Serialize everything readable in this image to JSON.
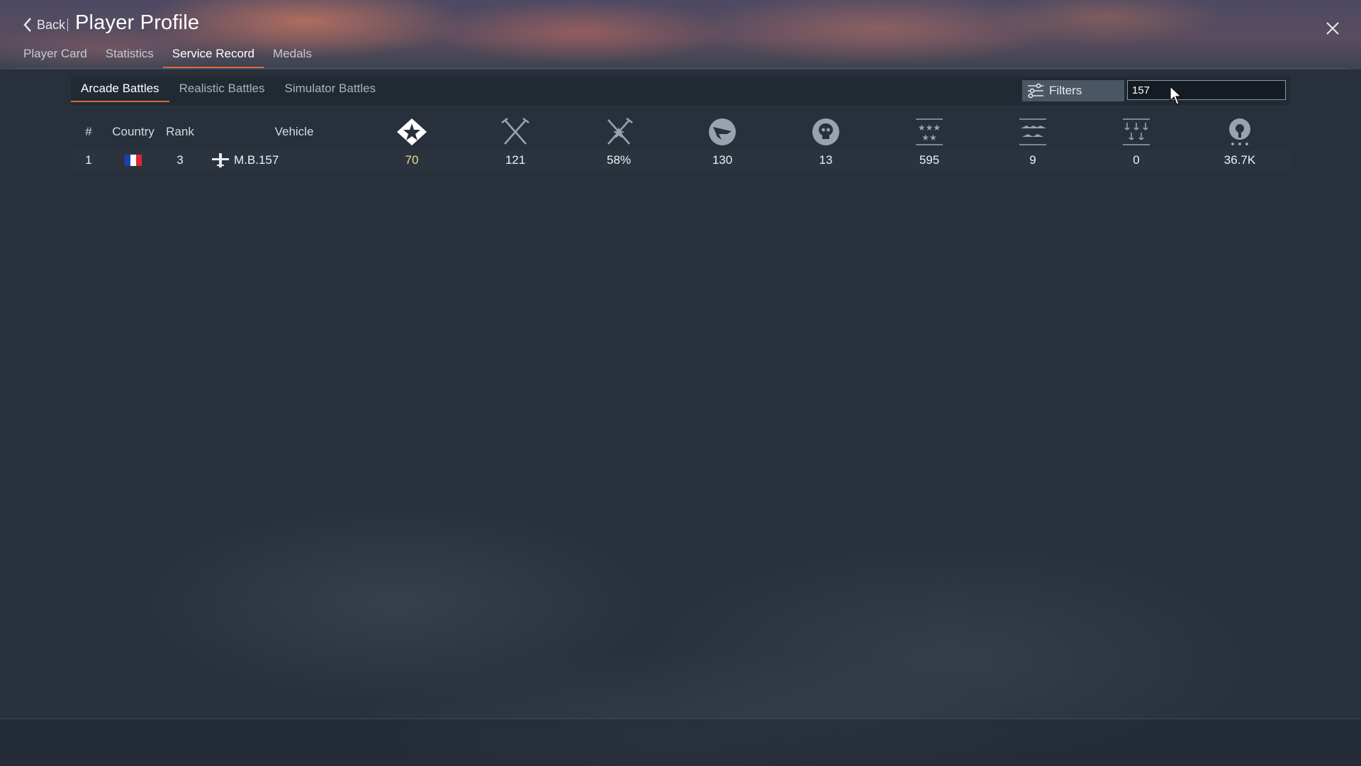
{
  "header": {
    "back_label": "Back",
    "title": "Player Profile",
    "close_icon": "close-icon"
  },
  "main_tabs": [
    {
      "label": "Player Card",
      "active": false
    },
    {
      "label": "Statistics",
      "active": false
    },
    {
      "label": "Service Record",
      "active": true
    },
    {
      "label": "Medals",
      "active": false
    }
  ],
  "sub_tabs": [
    {
      "label": "Arcade Battles",
      "active": true
    },
    {
      "label": "Realistic Battles",
      "active": false
    },
    {
      "label": "Simulator Battles",
      "active": false
    }
  ],
  "filters": {
    "label": "Filters",
    "icon": "filter-sliders-icon"
  },
  "search": {
    "value": "157",
    "placeholder": ""
  },
  "table": {
    "columns": [
      {
        "label": "#",
        "icon": null
      },
      {
        "label": "Country",
        "icon": null
      },
      {
        "label": "Rank",
        "icon": null
      },
      {
        "label": "Vehicle",
        "icon": null
      },
      {
        "label": "",
        "icon": "victories-star-icon"
      },
      {
        "label": "",
        "icon": "battles-crossed-swords-icon"
      },
      {
        "label": "",
        "icon": "win-rate-swords-icon"
      },
      {
        "label": "",
        "icon": "air-kills-icon"
      },
      {
        "label": "",
        "icon": "deaths-skull-icon"
      },
      {
        "label": "",
        "icon": "ground-kills-stars-icon"
      },
      {
        "label": "",
        "icon": "naval-kills-icon"
      },
      {
        "label": "",
        "icon": "ship-kills-anchors-icon"
      },
      {
        "label": "",
        "icon": "research-points-icon"
      }
    ],
    "rows": [
      {
        "num": "1",
        "country_flag": "france",
        "flag_colors": [
          "#1f3fb0",
          "#ffffff",
          "#e1262d"
        ],
        "rank": "3",
        "vehicle_icon": "aircraft-icon",
        "vehicle": "M.B.157",
        "victories": "70",
        "battles": "121",
        "win_rate": "58%",
        "air_kills": "130",
        "deaths": "13",
        "ground_kills": "595",
        "naval_kills": "9",
        "ship_kills": "0",
        "rp": "36.7K"
      }
    ]
  },
  "colors": {
    "accent": "#d86a3c",
    "highlight_value": "#f1da9b"
  }
}
